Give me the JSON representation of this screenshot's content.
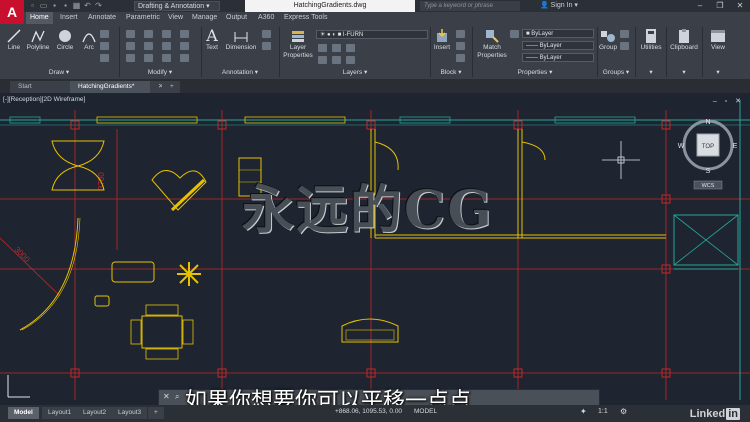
{
  "titlebar": {
    "logo": "A",
    "workspace": "Drafting & Annotation",
    "file_title": "HatchingGradients.dwg",
    "search_placeholder": "Type a keyword or phrase",
    "sign_in": "Sign In"
  },
  "ribbon_tabs": [
    "Home",
    "Insert",
    "Annotate",
    "Parametric",
    "View",
    "Manage",
    "Output",
    "A360",
    "Express Tools"
  ],
  "ribbon": {
    "draw": {
      "line": "Line",
      "polyline": "Polyline",
      "circle": "Circle",
      "arc": "Arc",
      "panel": "Draw"
    },
    "modify": {
      "panel": "Modify"
    },
    "annotation": {
      "text": "Text",
      "dimension": "Dimension",
      "panel": "Annotation"
    },
    "layers": {
      "layer_properties": "Layer Properties",
      "current_layer": "I-FURN",
      "panel": "Layers"
    },
    "block": {
      "insert": "Insert",
      "panel": "Block"
    },
    "properties": {
      "match": "Match Properties",
      "color": "ByLayer",
      "linetype": "ByLayer",
      "lineweight": "ByLayer",
      "panel": "Properties"
    },
    "groups": {
      "group": "Group",
      "panel": "Groups"
    },
    "utilities": "Utilities",
    "clipboard": "Clipboard",
    "view": "View"
  },
  "doc_tabs": [
    "Start",
    "HatchingGradients*"
  ],
  "viewport": {
    "label": "[-][Reception][2D Wireframe]",
    "controls": "– ▫ ✕",
    "viewcube": {
      "top": "TOP",
      "n": "N",
      "s": "S",
      "w": "W",
      "e": "E",
      "wcs": "WCS"
    },
    "dims": [
      "3780",
      "3000"
    ]
  },
  "watermark": "永远的CG",
  "subtitle": "如果你想要你可以平移一点点",
  "layout_tabs": [
    "Model",
    "Layout1",
    "Layout2",
    "Layout3"
  ],
  "status": {
    "coords": "+868.06, 1095.53, 0.00",
    "mode": "MODEL",
    "scale": "1:1"
  },
  "brand": "Linked",
  "brand_in": "in",
  "colors": {
    "accent": "#c8102e",
    "wall": "#c62828",
    "furn": "#e6c200",
    "glass": "#26a69a"
  }
}
